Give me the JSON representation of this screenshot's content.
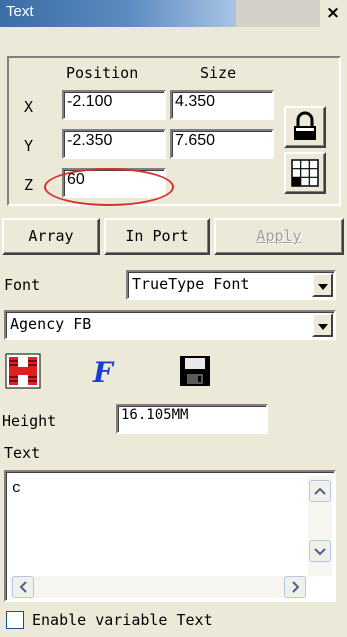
{
  "window": {
    "title": "Text",
    "close_glyph": "×"
  },
  "position_size": {
    "position_header": "Position",
    "size_header": "Size",
    "x_label": "X",
    "y_label": "Y",
    "z_label": "Z",
    "x_position": "-2.100",
    "x_size": "4.350",
    "y_position": "-2.350",
    "y_size": "7.650",
    "z_value": "60",
    "lock_icon": "lock-icon",
    "grid_icon": "base-point-grid-icon",
    "highlight_color": "#d43030"
  },
  "buttons": {
    "array": "Array",
    "in_port": "In Port",
    "apply": "Apply"
  },
  "font": {
    "font_label": "Font",
    "font_type": "TrueType Font",
    "font_name": "Agency FB",
    "height_label": "Height",
    "height_value": "16.105MM"
  },
  "toolbar_icons": [
    "hatch-icon",
    "font-settings-icon",
    "save-icon"
  ],
  "text": {
    "text_label": "Text",
    "content": "c"
  },
  "enable_variable_text": {
    "label": "Enable variable Text",
    "checked": false
  }
}
